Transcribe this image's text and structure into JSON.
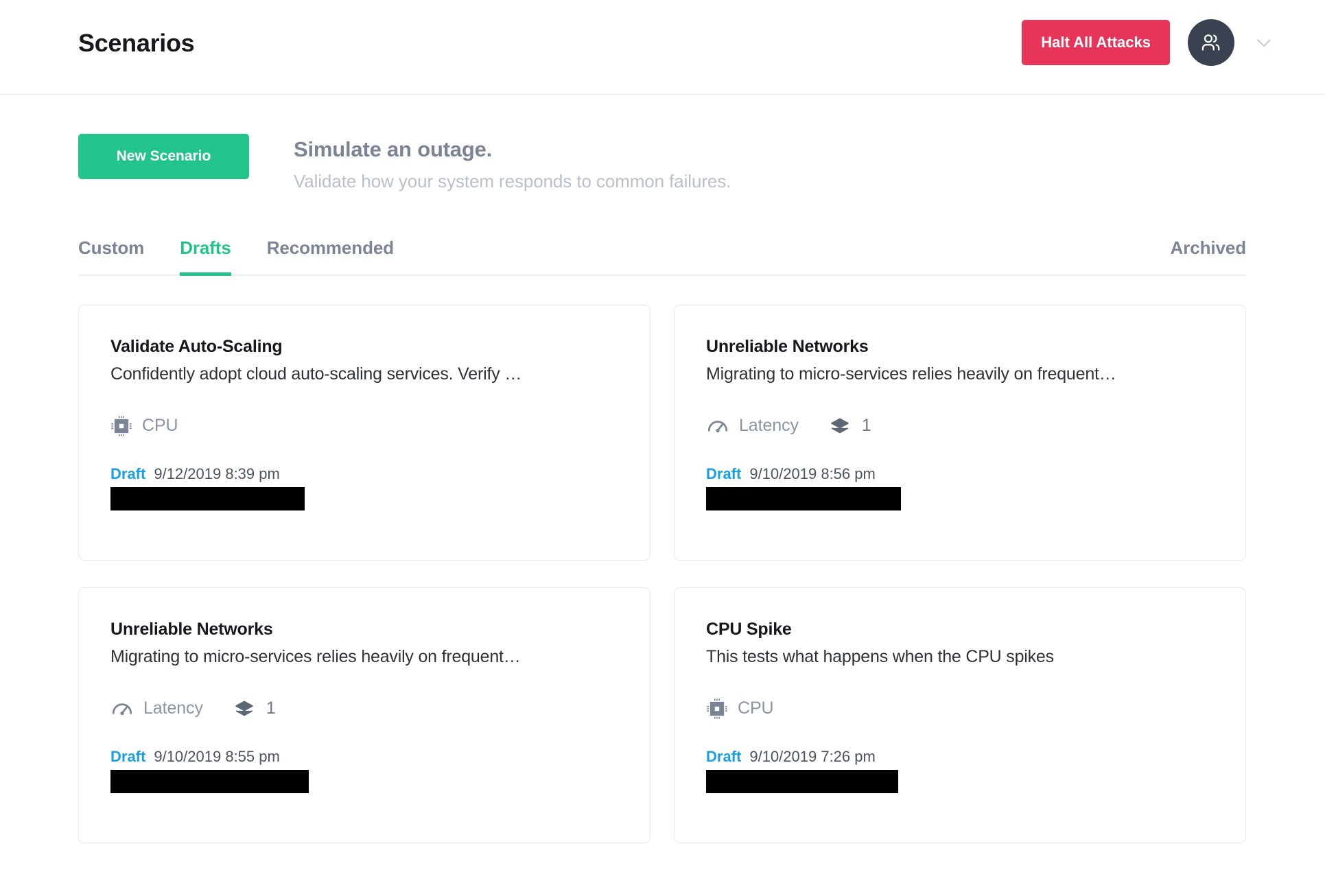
{
  "header": {
    "title": "Scenarios",
    "halt_button_label": "Halt All Attacks",
    "avatar_icon": "users-icon",
    "caret_icon": "chevron-down-icon"
  },
  "hero": {
    "new_scenario_label": "New Scenario",
    "title": "Simulate an outage.",
    "subtitle": "Validate how your system responds to common failures."
  },
  "tabs": {
    "items": [
      {
        "label": "Custom",
        "active": false
      },
      {
        "label": "Drafts",
        "active": true
      },
      {
        "label": "Recommended",
        "active": false
      }
    ],
    "archived_label": "Archived"
  },
  "colors": {
    "accent_green": "#22c48c",
    "danger_red": "#e63559",
    "link_blue": "#1a9fe0",
    "muted_gray": "#7b8494",
    "redaction_black": "#000000"
  },
  "cards": [
    {
      "title": "Validate Auto-Scaling",
      "description": "Confidently adopt cloud auto-scaling services. Verify …",
      "attack_icon": "cpu-chip-icon",
      "attack_label": "CPU",
      "layers_icon": null,
      "layers_count": null,
      "status": "Draft",
      "timestamp": "9/12/2019 8:39 pm",
      "redaction_width": 283
    },
    {
      "title": "Unreliable Networks",
      "description": "Migrating to micro-services relies heavily on frequent…",
      "attack_icon": "gauge-latency-icon",
      "attack_label": "Latency",
      "layers_icon": "layers-icon",
      "layers_count": "1",
      "status": "Draft",
      "timestamp": "9/10/2019 8:56 pm",
      "redaction_width": 284
    },
    {
      "title": "Unreliable Networks",
      "description": "Migrating to micro-services relies heavily on frequent…",
      "attack_icon": "gauge-latency-icon",
      "attack_label": "Latency",
      "layers_icon": "layers-icon",
      "layers_count": "1",
      "status": "Draft",
      "timestamp": "9/10/2019 8:55 pm",
      "redaction_width": 289
    },
    {
      "title": "CPU Spike",
      "description": "This tests what happens when the CPU spikes",
      "attack_icon": "cpu-chip-icon",
      "attack_label": "CPU",
      "layers_icon": null,
      "layers_count": null,
      "status": "Draft",
      "timestamp": "9/10/2019 7:26 pm",
      "redaction_width": 280
    }
  ]
}
